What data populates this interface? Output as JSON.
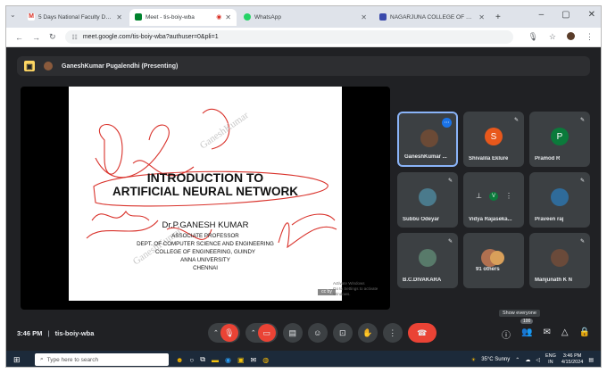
{
  "browser": {
    "tabs": [
      {
        "title": "5 Days National Faculty Develo",
        "favicon_color": "#d93025",
        "favicon_letter": "M"
      },
      {
        "title": "Meet - tis-boiy-wba",
        "favicon_color": "#00832d",
        "favicon_letter": "",
        "active": true,
        "recording_dot": "◉"
      },
      {
        "title": "WhatsApp",
        "favicon_color": "#25d366",
        "favicon_letter": ""
      },
      {
        "title": "NAGARJUNA COLLEGE OF ENG",
        "favicon_color": "#3949ab",
        "favicon_letter": ""
      }
    ],
    "new_tab": "+",
    "url": "meet.google.com/tis-boiy-wba?authuser=0&pli=1",
    "window_controls": [
      "–",
      "▢",
      "✕"
    ]
  },
  "meet": {
    "presenter_label": "GaneshKumar Pugalendhi (Presenting)",
    "meeting_time": "3:46 PM",
    "meeting_code": "tis-boiy-wba",
    "show_everyone_tooltip": "Show everyone",
    "participant_count": "100",
    "participants": [
      {
        "name": "GaneshKumar ...",
        "type": "photo",
        "color": "#6b4a36",
        "selected": true
      },
      {
        "name": "Shivalila Eklure",
        "type": "letter",
        "letter": "S",
        "color": "#e8581c"
      },
      {
        "name": "Pramod R",
        "type": "letter",
        "letter": "P",
        "color": "#0b7a3b"
      },
      {
        "name": "Subbu Odeyar",
        "type": "photo",
        "color": "#4a7a8c"
      },
      {
        "name": "Vidya Rajaseka...",
        "type": "controls",
        "color": "#3c4043"
      },
      {
        "name": "Praveen raj",
        "type": "photo",
        "color": "#2f6b9a"
      },
      {
        "name": "B.C.DIVAKARA",
        "type": "photo",
        "color": "#587a6a"
      },
      {
        "name": "91 others",
        "type": "group",
        "color": "#b07050"
      },
      {
        "name": "Manjunath K N",
        "type": "photo",
        "color": "#6a4a3a"
      }
    ]
  },
  "slide": {
    "title_line1": "INTRODUCTION TO",
    "title_line2": "ARTIFICIAL NEURAL NETWORK",
    "author": "Dr.P.GANESH KUMAR",
    "designation": "ASSOCIATE PROFESSOR",
    "department": "DEPT. OF COMPUTER SCIENCE AND ENGINEERING",
    "college": "COLLEGE OF ENGINEERING, GUINDY",
    "university": "ANNA UNIVERSITY",
    "city": "CHENNAI",
    "cc_badge": "cc by",
    "watermark_line1": "Activate Windows",
    "watermark_line2": "Go to Settings to activate Windows."
  },
  "taskbar": {
    "search_placeholder": "Type here to search",
    "weather": "35°C  Sunny",
    "language": "ENG",
    "region": "IN",
    "time": "3:46 PM",
    "date": "4/15/2024"
  }
}
